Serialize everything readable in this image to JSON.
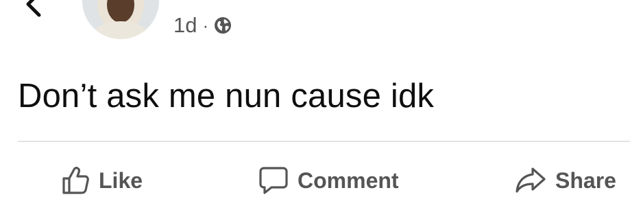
{
  "post": {
    "author_name": "",
    "timestamp": "1d",
    "separator": "·",
    "privacy_icon": "globe-icon",
    "text": "Don’t ask me nun cause idk"
  },
  "header": {
    "back_icon": "chevron-left-icon"
  },
  "actions": {
    "like_label": "Like",
    "comment_label": "Comment",
    "share_label": "Share"
  },
  "colors": {
    "text": "#111111",
    "muted": "#555555",
    "divider": "#e2e2e2",
    "background": "#ffffff"
  }
}
